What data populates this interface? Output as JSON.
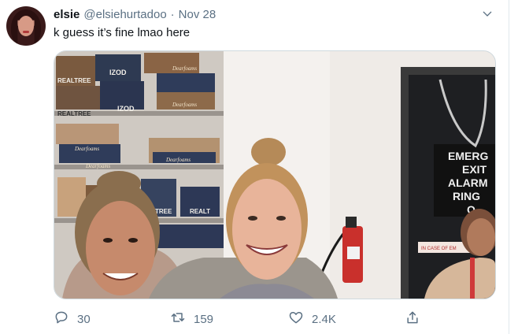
{
  "tweet": {
    "author_name": "elsie",
    "author_handle": "@elsiehurtadoo",
    "separator": "·",
    "date": "Nov 28",
    "text": "k guess it’s fine lmao here"
  },
  "photo": {
    "box_labels": [
      "REALTREE",
      "IZOD",
      "REALTREE",
      "IZOD",
      "Dearfoams",
      "Dearfoams",
      "Dearfoams",
      "Dearfoams",
      "Dearfoams",
      "TREE",
      "REALT"
    ],
    "sign_lines": [
      "EMERG",
      "EXIT",
      "ALARM",
      "RING",
      "O"
    ],
    "small_sign": "IN CASE OF EM"
  },
  "actions": {
    "reply_count": "30",
    "retweet_count": "159",
    "like_count": "2.4K"
  },
  "icons": {
    "caret": "chevron-down-icon",
    "reply": "reply-icon",
    "retweet": "retweet-icon",
    "like": "heart-icon",
    "share": "share-icon"
  },
  "colors": {
    "muted_text": "#5b7083",
    "border": "#cfd9de"
  }
}
